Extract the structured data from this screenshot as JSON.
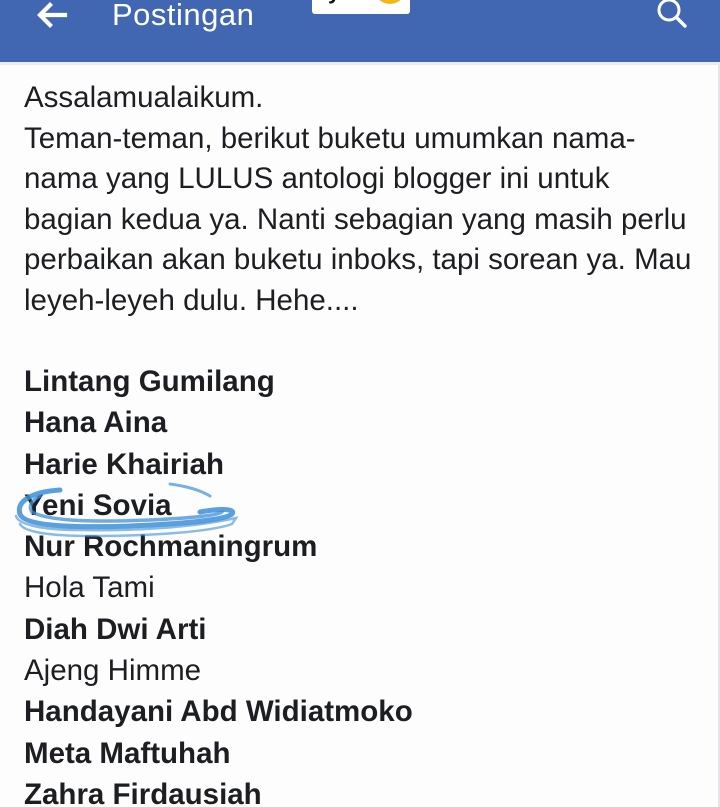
{
  "header": {
    "title": "Postingan",
    "sticker_text": "ya",
    "back_icon": "arrow-left-icon",
    "search_icon": "search-icon",
    "bar_color": "#4267b2"
  },
  "post": {
    "greeting": "Assalamualaikum.",
    "body": "Teman-teman, berikut buketu umumkan nama-nama yang LULUS antologi blogger ini untuk bagian kedua ya. Nanti sebagian yang masih perlu perbaikan akan buketu inboks, tapi sorean ya. Mau leyeh-leyeh dulu. Hehe....",
    "names": [
      {
        "text": "Lintang Gumilang",
        "bold": true
      },
      {
        "text": "Hana Aina",
        "bold": true
      },
      {
        "text": "Harie Khairiah",
        "bold": true
      },
      {
        "text": "Yeni Sovia",
        "bold": true,
        "circled": true
      },
      {
        "text": "Nur Rochmaningrum",
        "bold": true
      },
      {
        "text": "Hola Tami",
        "bold": false
      },
      {
        "text": "Diah Dwi Arti",
        "bold": true
      },
      {
        "text": "Ajeng Himme",
        "bold": false
      },
      {
        "text": "Handayani Abd Widiatmoko",
        "bold": true
      },
      {
        "text": "Meta Maftuhah",
        "bold": true
      },
      {
        "text": "Zahra Firdausiah",
        "bold": true
      }
    ],
    "highlight_color": "#3d8fd8"
  }
}
